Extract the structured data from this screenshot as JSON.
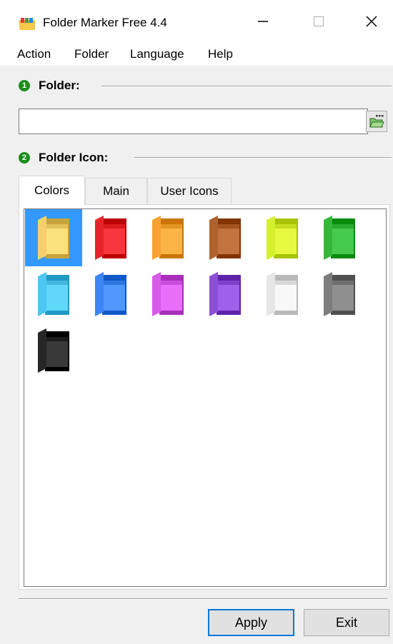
{
  "window": {
    "title": "Folder Marker Free 4.4",
    "minimize_glyph": "—",
    "maximize_glyph": "☐",
    "close_glyph": "✕"
  },
  "menu": [
    "Action",
    "Folder",
    "Language",
    "Help"
  ],
  "folder_section": {
    "number": "1",
    "label": "Folder:",
    "input_value": "",
    "input_placeholder": ""
  },
  "icon_section": {
    "number": "2",
    "label": "Folder Icon:"
  },
  "tabs": [
    {
      "label": "Colors",
      "active": true
    },
    {
      "label": "Main",
      "active": false
    },
    {
      "label": "User Icons",
      "active": false
    }
  ],
  "color_icons": [
    {
      "name": "yellow",
      "color": "#f5cf6b",
      "selected": true
    },
    {
      "name": "red",
      "color": "#e8232b",
      "selected": false
    },
    {
      "name": "orange",
      "color": "#f7a233",
      "selected": false
    },
    {
      "name": "brown",
      "color": "#b0622d",
      "selected": false
    },
    {
      "name": "lime",
      "color": "#d4f02e",
      "selected": false
    },
    {
      "name": "green",
      "color": "#34b83a",
      "selected": false
    },
    {
      "name": "light-blue",
      "color": "#4ec6f2",
      "selected": false
    },
    {
      "name": "blue",
      "color": "#3d85f5",
      "selected": false
    },
    {
      "name": "pink",
      "color": "#d65ce8",
      "selected": false
    },
    {
      "name": "purple",
      "color": "#8c4fd6",
      "selected": false
    },
    {
      "name": "white",
      "color": "#e6e6e6",
      "selected": false
    },
    {
      "name": "gray",
      "color": "#7d7d7d",
      "selected": false
    },
    {
      "name": "black",
      "color": "#262626",
      "selected": false
    }
  ],
  "buttons": {
    "apply": "Apply",
    "exit": "Exit"
  }
}
